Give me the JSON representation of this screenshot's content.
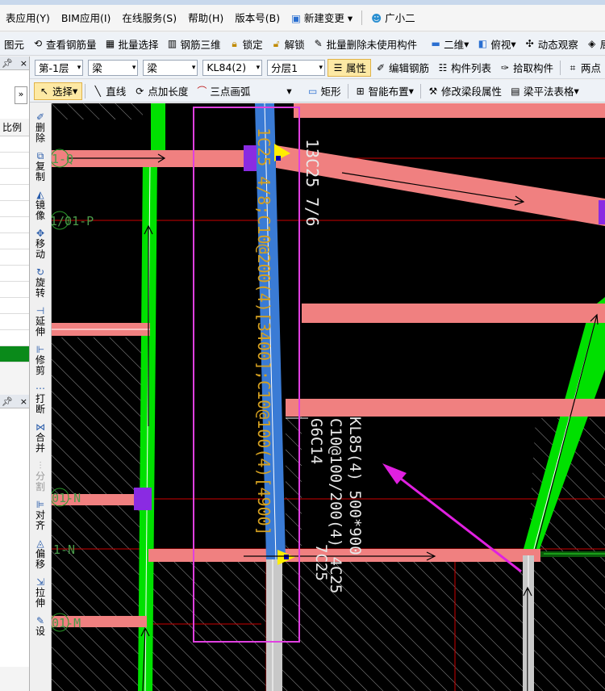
{
  "menu": {
    "items": [
      "表应用(Y)",
      "BIM应用(I)",
      "在线服务(S)",
      "帮助(H)",
      "版本号(B)",
      "新建变更",
      "广小二"
    ]
  },
  "toolbar1": {
    "items": [
      "图元",
      "查看钢筋量",
      "批量选择",
      "钢筋三维",
      "锁定",
      "解锁",
      "批量删除未使用构件",
      "二维",
      "俯视",
      "动态观察",
      "局部"
    ]
  },
  "toolbar2": {
    "floor": "第-1层",
    "type": "梁",
    "subtype": "梁",
    "element": "KL84(2)",
    "layer": "分层1",
    "buttons": [
      "属性",
      "编辑钢筋",
      "构件列表",
      "拾取构件",
      "两点"
    ]
  },
  "toolbar3": {
    "items": [
      "选择",
      "直线",
      "点加长度",
      "三点画弧",
      "矩形",
      "智能布置",
      "修改梁段属性",
      "梁平法表格"
    ]
  },
  "left_panel": {
    "top_label": "比例",
    "expand": "»"
  },
  "left_tools": [
    "删除",
    "复制",
    "镜像",
    "移动",
    "旋转",
    "延伸",
    "修剪",
    "打断",
    "合并",
    "分割",
    "对齐",
    "偏移",
    "拉伸",
    "设"
  ],
  "canvas": {
    "axes": [
      "1-Q",
      "1/01-P",
      "01-N",
      "1-N",
      "01-M"
    ],
    "beam_text_vertical": "1C25 4/8;C10@200(4)[3400];C10@100(4)[4900]",
    "beam_text_rebar": "13C25 7/6",
    "kl85_lines": [
      "KL85(4) 500*900",
      "C10@100/200(4) 4C25",
      "G6C14",
      "7C25"
    ]
  },
  "colors": {
    "beam": "#f08080",
    "column": "#00e000",
    "selected_beam": "#3a7bd5",
    "highlight_box": "#e040e0",
    "annotation_arrow": "#e020e0",
    "axis_line": "#cc0000"
  }
}
